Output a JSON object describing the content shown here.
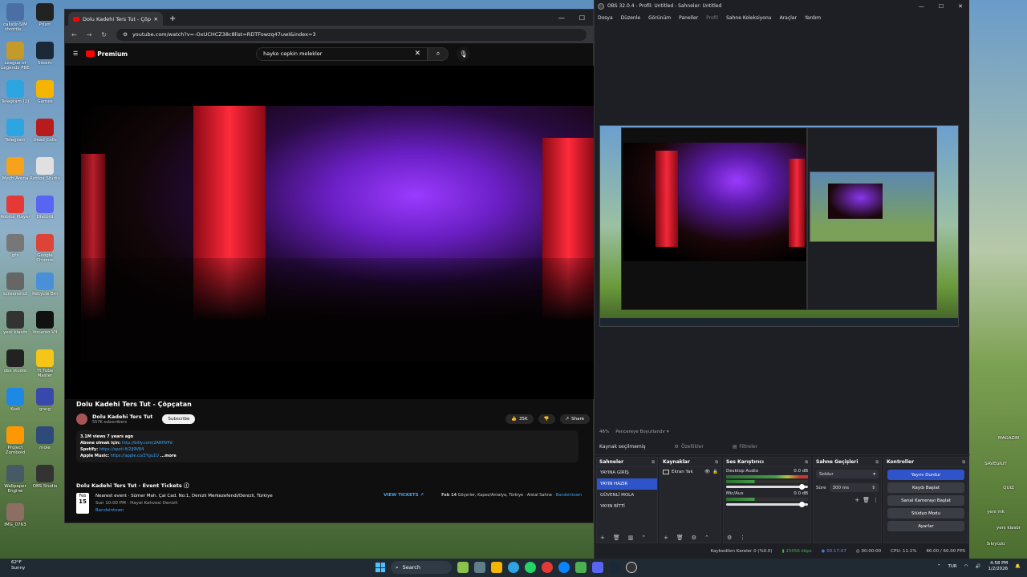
{
  "desktop": {
    "left_icons": [
      {
        "label": "calistir-SIM\nthrottle..."
      },
      {
        "label": "Prism"
      },
      {
        "label": "League of Legends PBE"
      },
      {
        "label": "Steam"
      },
      {
        "label": "Telegram (2)"
      },
      {
        "label": "Games"
      },
      {
        "label": "Telegram"
      },
      {
        "label": "Dead Cells"
      },
      {
        "label": "Mech Arena"
      },
      {
        "label": "Roblox Studio"
      },
      {
        "label": "Roblox Player"
      },
      {
        "label": "Discord"
      },
      {
        "label": "gfx"
      },
      {
        "label": "Google Chrome"
      },
      {
        "label": "screenshot"
      },
      {
        "label": "Recycle Bin"
      },
      {
        "label": "yeni klasör"
      },
      {
        "label": "Vocaroo V3"
      },
      {
        "label": "obs studio"
      },
      {
        "label": "Yt Tube Master"
      },
      {
        "label": "Kodi"
      },
      {
        "label": "gnng"
      },
      {
        "label": "Project Zomboid"
      },
      {
        "label": "mole"
      },
      {
        "label": "Wallpaper Engine"
      },
      {
        "label": "OBS Studio"
      },
      {
        "label": "IMG_0763"
      }
    ],
    "right_icons": [
      {
        "label": "MAGAZIN"
      },
      {
        "label": "SAVEGIUT"
      },
      {
        "label": "QUIZ"
      },
      {
        "label": "yeni mk"
      },
      {
        "label": "yeni klasör"
      },
      {
        "label": "Sıkıyüzü"
      }
    ]
  },
  "browser": {
    "tab_title": "Dolu Kadehi Ters Tut - Çöpçatan",
    "url": "youtube.com/watch?v=-OxUCHCZ38c8list=RDTFowzq47uwI&index=3",
    "youtube": {
      "logo_text": "Premium",
      "search_query": "hayko cepkin melekler",
      "video_title": "Dolu Kadehi Ters Tut - Çöpçatan",
      "channel_name": "Dolu Kadehi Ters Tut",
      "subscribers": "557K subscribers",
      "subscribe_label": "Subscribe",
      "likes": "35K",
      "share_label": "Share",
      "desc_stats": "3.1M views  7 years ago",
      "desc_line1_label": "Abone olmak için:",
      "desc_line1_link": "http://bitly.com/2ARHVPd",
      "desc_line2_label": "Spotify:",
      "desc_line2_link": "https://spoti.fi/2lJ9V84",
      "desc_line3_label": "Apple Music:",
      "desc_line3_link": "https://apple.co/2Ygu1U",
      "desc_more": "...more",
      "events_title": "Dolu Kadehi Ters Tut - Event Tickets",
      "event1_month": "Feb",
      "event1_day": "15",
      "event1_title": "Nearest event · Sümer Mah. Çal Cad. No:1, Denizli Merkezefendi/Denizli, Türkiye",
      "event1_time": "Sun 10:00 PM · Hayal Kahvesi Denizli",
      "event1_vendor": "Bandsintown",
      "view_tickets": "VIEW TICKETS",
      "event2_date": "Feb 14",
      "event2_text": "Göçerler, Kapez/Antalya, Türkiye · Aistal Sahne ·",
      "event2_vendor": "Bandsintown"
    }
  },
  "obs": {
    "title": "OBS 32.0.4 - Profil: Untitled - Sahneler: Untitled",
    "menu": [
      "Dosya",
      "Düzenle",
      "Görünüm",
      "Paneller",
      "Profil",
      "Sahne Koleksiyonu",
      "Araçlar",
      "Yardım"
    ],
    "zoom": "46%",
    "fit_label": "Pencereye Boyutlandır",
    "no_source": "Kaynak seçilmemiş",
    "props_label": "Özellikler",
    "filters_label": "Filtreler",
    "docks": {
      "scenes_title": "Sahneler",
      "scenes": [
        "YAYINA GİRİŞ",
        "YAYIN HAZIR",
        "GÜVENLİ MOLA",
        "YAYIN BİTTİ"
      ],
      "sources_title": "Kaynaklar",
      "source1": "Ekran Yak",
      "mixer_title": "Ses Karıştırıcı",
      "ch1_name": "Desktop Audio",
      "ch1_db": "0.0 dB",
      "ch2_name": "Mic/Aux",
      "ch2_db": "0.0 dB",
      "transitions_title": "Sahne Geçişleri",
      "transition": "Soldur",
      "duration_label": "Süre",
      "duration": "300 ms",
      "controls_title": "Kontroller",
      "btn_stream": "Yayını Durdur",
      "btn_record": "Kaydı Başlat",
      "btn_vcam": "Sanal Kamerayı Başlat",
      "btn_studio": "Stüdyo Modu",
      "btn_settings": "Ayarlar"
    },
    "status": {
      "dropped": "Kaybedilen Kareler 0 (%0.0)",
      "bitrate": "15056 kbps",
      "stream_time": "00:17:07",
      "rec_time": "00:00:00",
      "cpu": "CPU: 11.1%",
      "fps": "60.00 / 60.00 FPS"
    }
  },
  "taskbar": {
    "weather_temp": "62°F",
    "weather_desc": "Sunny",
    "search_label": "Search",
    "lang": "TUR",
    "time": "4:58 PM",
    "date": "1/2/2026"
  }
}
